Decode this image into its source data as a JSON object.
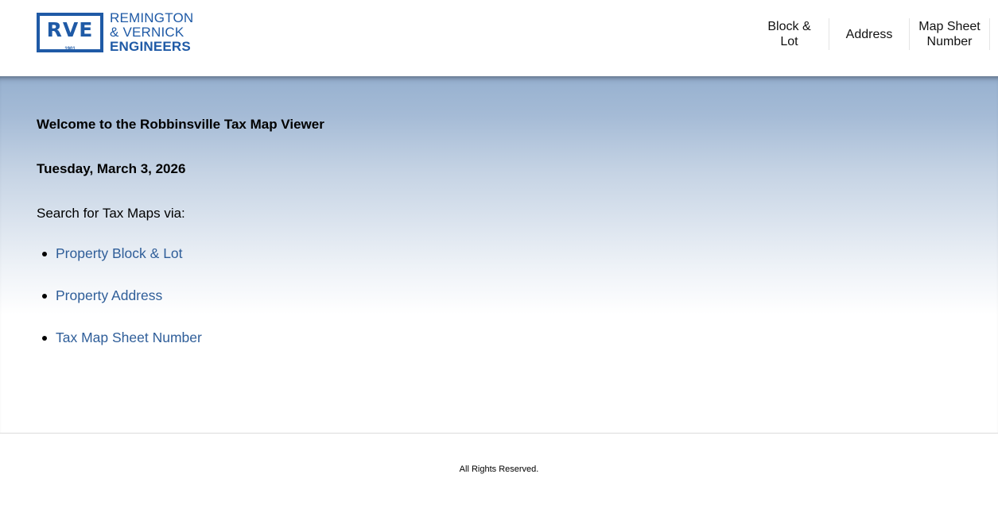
{
  "header": {
    "logo": {
      "mark": "RVE",
      "year": "1901",
      "line1": "REMINGTON",
      "line2": "& VERNICK",
      "line3": "ENGINEERS"
    },
    "nav": [
      {
        "label": "Block & Lot"
      },
      {
        "label": "Address"
      },
      {
        "label": "Map Sheet\nNumber"
      }
    ]
  },
  "main": {
    "welcome": "Welcome to the Robbinsville Tax Map Viewer",
    "date": "Tuesday, March 3, 2026",
    "search_label": "Search for Tax Maps via:",
    "links": [
      {
        "label": "Property Block & Lot"
      },
      {
        "label": "Property Address"
      },
      {
        "label": "Tax Map Sheet Number"
      }
    ]
  },
  "footer": {
    "text": "All Rights Reserved."
  },
  "colors": {
    "brand": "#1f5aa6",
    "link": "#2f5e99"
  }
}
